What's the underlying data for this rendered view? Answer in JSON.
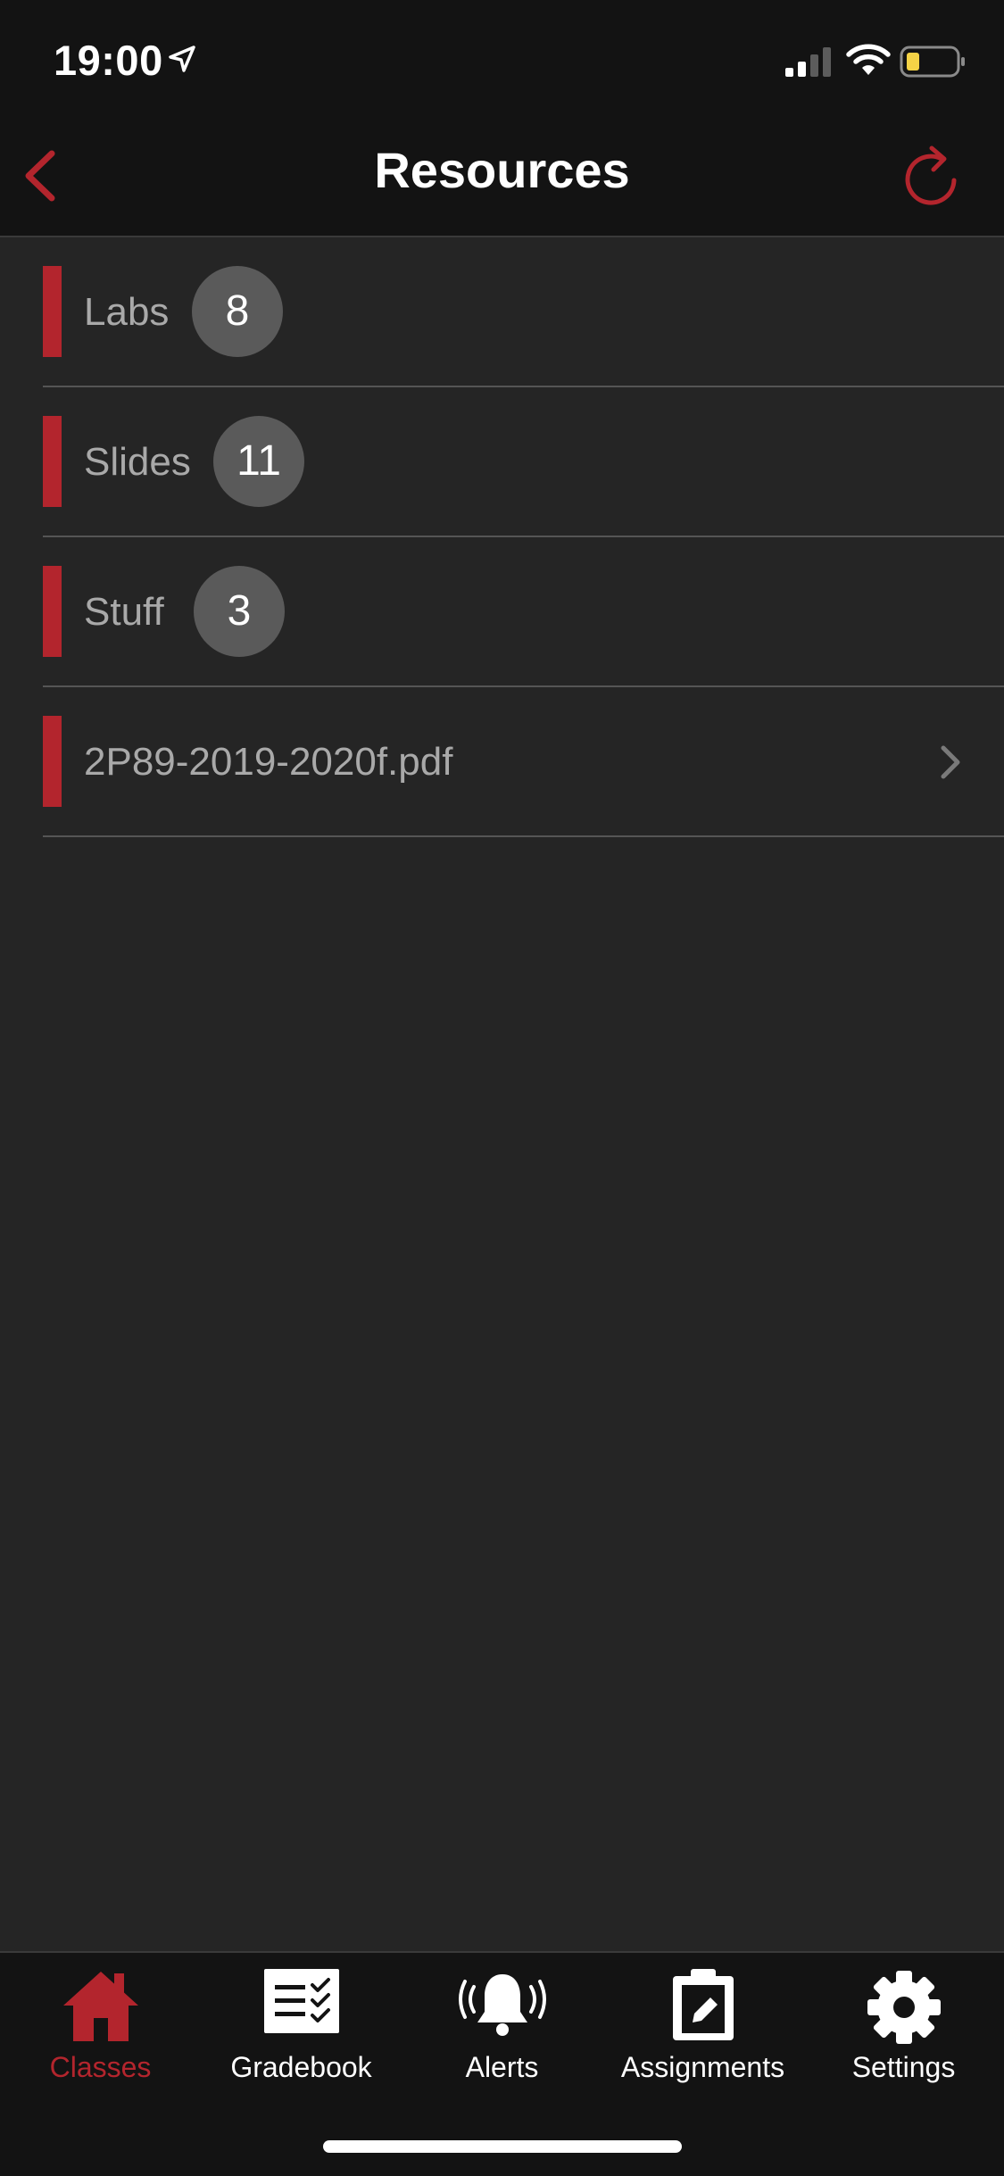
{
  "status": {
    "time": "19:00",
    "location_icon": "location-arrow-icon",
    "signal_icon": "cell-signal-icon",
    "wifi_icon": "wifi-icon",
    "battery_icon": "battery-icon"
  },
  "nav": {
    "title": "Resources",
    "back_icon": "chevron-left-icon",
    "refresh_icon": "refresh-icon"
  },
  "list": [
    {
      "label": "Labs",
      "count": "8"
    },
    {
      "label": "Slides",
      "count": "11"
    },
    {
      "label": "Stuff",
      "count": "3"
    },
    {
      "label": "2P89-2019-2020f.pdf"
    }
  ],
  "tabs": [
    {
      "label": "Classes",
      "icon": "home-icon",
      "active": true
    },
    {
      "label": "Gradebook",
      "icon": "gradebook-icon"
    },
    {
      "label": "Alerts",
      "icon": "bell-icon"
    },
    {
      "label": "Assignments",
      "icon": "clipboard-icon"
    },
    {
      "label": "Settings",
      "icon": "gear-icon"
    }
  ],
  "colors": {
    "accent": "#b3252d",
    "background": "#252525",
    "bar": "#131313",
    "badge": "#5a5a5a",
    "label": "#a9a9a9"
  }
}
